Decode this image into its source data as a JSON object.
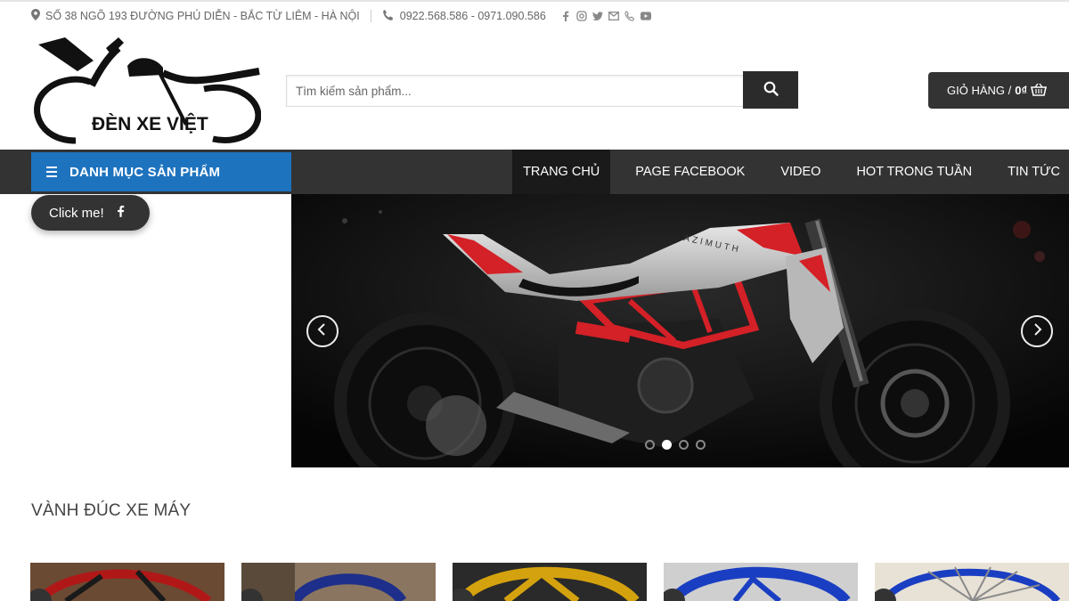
{
  "topbar": {
    "address": "SỐ 38 NGÕ 193 ĐƯỜNG PHÚ DIỄN - BẮC TỪ LIÊM - HÀ NỘI",
    "phone": "0922.568.586 - 0971.090.586",
    "socials": [
      "facebook-icon",
      "instagram-icon",
      "twitter-icon",
      "email-icon",
      "phone-icon",
      "youtube-icon"
    ]
  },
  "logo": {
    "text": "ĐÈN XE VIỆT"
  },
  "search": {
    "placeholder": "Tìm kiếm sản phẩm..."
  },
  "cart": {
    "label": "GIỎ HÀNG /",
    "amount": "0₫"
  },
  "nav": {
    "category_label": "DANH MỤC SẢN PHẨM",
    "items": [
      "TRANG CHỦ",
      "PAGE FACEBOOK",
      "VIDEO",
      "HOT TRONG TUẦN",
      "TIN TỨC"
    ]
  },
  "floating": {
    "label": "Click me!"
  },
  "slider": {
    "slide_count": 4,
    "active_slide": 1,
    "brand_text": "AZIMUTH"
  },
  "section": {
    "title": "VÀNH ĐÚC XE MÁY"
  },
  "colors": {
    "accent": "#1e73be",
    "dark": "#333333",
    "bike_red": "#d42027"
  }
}
